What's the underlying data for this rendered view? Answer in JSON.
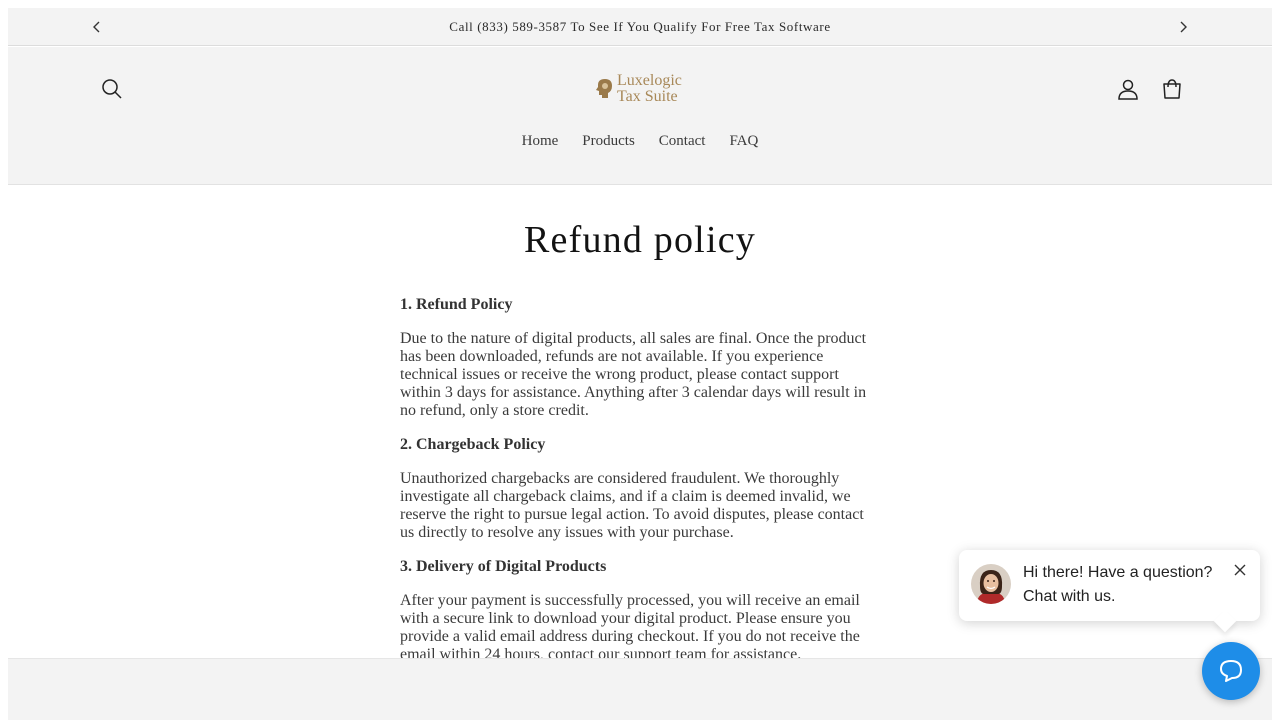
{
  "announcement": {
    "text": "Call (833) 589-3587 To See If You Qualify For Free Tax Software",
    "prev_icon": "chevron-left-icon",
    "next_icon": "chevron-right-icon"
  },
  "header": {
    "logo": {
      "line1": "Luxelogic",
      "line2": "Tax Suite",
      "color": "#a88858"
    },
    "icons": [
      "search-icon",
      "account-icon",
      "cart-icon"
    ],
    "nav": [
      {
        "label": "Home"
      },
      {
        "label": "Products"
      },
      {
        "label": "Contact"
      },
      {
        "label": "FAQ"
      }
    ]
  },
  "page": {
    "title": "Refund policy",
    "sections": [
      {
        "heading": "1. Refund Policy",
        "body": "Due to the nature of digital products, all sales are final. Once the product has been downloaded, refunds are not available. If you experience technical issues or receive the wrong product, please contact support within 3 days for assistance. Anything after 3 calendar days will result in no refund, only a store credit."
      },
      {
        "heading": "2. Chargeback Policy",
        "body": "Unauthorized chargebacks are considered fraudulent. We thoroughly investigate all chargeback claims, and if a claim is deemed invalid, we reserve the right to pursue legal action. To avoid disputes, please contact us directly to resolve any issues with your purchase."
      },
      {
        "heading": "3. Delivery of Digital Products",
        "body": "After your payment is successfully processed, you will receive an email with a secure link to download your digital product. Please ensure you provide a valid email address during checkout. If you do not receive the email within 24 hours, contact our support team for assistance."
      }
    ]
  },
  "chat": {
    "message": "Hi there! Have a question? Chat with us.",
    "accent": "#1e8de8",
    "close_icon": "close-icon",
    "launcher_icon": "chat-bubble-icon"
  }
}
